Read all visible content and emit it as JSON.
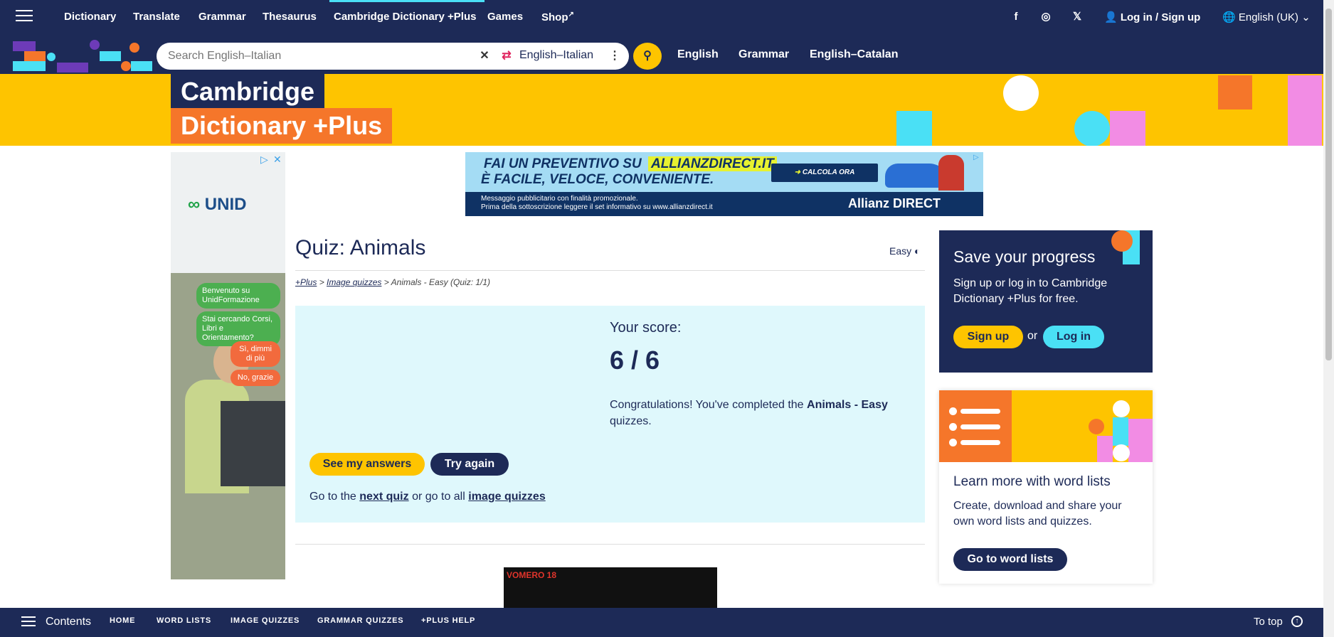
{
  "nav": {
    "links": [
      "Dictionary",
      "Translate",
      "Grammar",
      "Thesaurus",
      "Cambridge Dictionary +Plus",
      "Games",
      "Shop"
    ],
    "login": "Log in / Sign up",
    "language": "English (UK)"
  },
  "search": {
    "placeholder": "Search English–Italian",
    "dictionary": "English–Italian",
    "quick_links": [
      "English",
      "Grammar",
      "English–Catalan"
    ]
  },
  "banner": {
    "line1": "Cambridge",
    "line2": "Dictionary +Plus"
  },
  "ad_left": {
    "brand": "UNID",
    "bubbles": [
      "Benvenuto su UnidFormazione",
      "Stai cercando Corsi, Libri e Orientamento?",
      "Sì, dimmi di più",
      "No, grazie"
    ]
  },
  "ad_top": {
    "headline_pre": "FAI UN PREVENTIVO SU",
    "headline_brand": "ALLIANZDIRECT.IT",
    "subline": "È FACILE, VELOCE, CONVENIENTE.",
    "cta": "CALCOLA ORA",
    "small1": "Messaggio pubblicitario con finalità promozionale.",
    "small2": "Prima della sottoscrizione leggere il set informativo su www.allianzdirect.it",
    "brand": "Allianz DIRECT"
  },
  "quiz": {
    "title": "Quiz: Animals",
    "level": "Easy",
    "breadcrumb": {
      "plus": "+Plus",
      "image_quizzes": "Image quizzes",
      "current": "> Animals - Easy (Quiz: 1/1)"
    },
    "score_label": "Your score:",
    "score_value": "6 / 6",
    "congrats_pre": "Congratulations! You've completed the",
    "congrats_bold": "Animals - Easy",
    "congrats_post": "quizzes.",
    "see_answers": "See my answers",
    "try_again": "Try again",
    "goto_pre": "Go to the",
    "next_quiz": "next quiz",
    "goto_mid": "or go to all",
    "all_image_quizzes": "image quizzes"
  },
  "ad_bottom": {
    "text": "VOMERO 18"
  },
  "save_card": {
    "title": "Save your progress",
    "text": "Sign up or log in to Cambridge Dictionary +Plus for free.",
    "signup": "Sign up",
    "or": "or",
    "login": "Log in"
  },
  "wordlists_card": {
    "title": "Learn more with word lists",
    "text": "Create, download and share your own word lists and quizzes.",
    "button": "Go to word lists"
  },
  "bottom": {
    "contents": "Contents",
    "links": [
      "HOME",
      "WORD LISTS",
      "IMAGE QUIZZES",
      "GRAMMAR QUIZZES",
      "+PLUS HELP"
    ],
    "to_top": "To top"
  },
  "colors": {
    "navy": "#1d2a57",
    "yellow": "#fec400",
    "orange": "#f5762a",
    "cyan": "#4ae0f5",
    "pink": "#f28ce4"
  }
}
